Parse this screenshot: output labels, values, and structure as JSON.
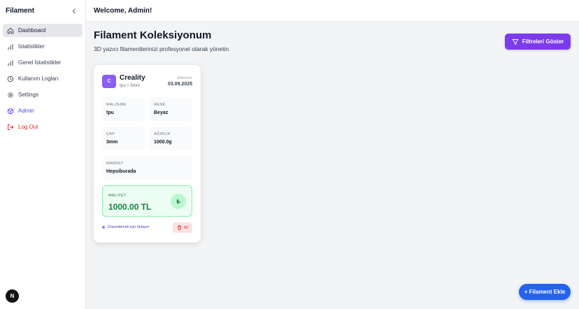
{
  "sidebar": {
    "brand": "Filament",
    "items": [
      {
        "label": "Dashboard",
        "icon": "home-icon"
      },
      {
        "label": "İstatistikler",
        "icon": "bar-chart-icon"
      },
      {
        "label": "Genel İstatistikler",
        "icon": "bar-chart-icon"
      },
      {
        "label": "Kullanım Logları",
        "icon": "clock-icon"
      },
      {
        "label": "Settings",
        "icon": "gear-icon"
      },
      {
        "label": "Admin",
        "icon": "cube-icon"
      },
      {
        "label": "Log Out",
        "icon": "logout-icon"
      }
    ],
    "badge": "N"
  },
  "topbar": {
    "title": "Welcome, Admin!"
  },
  "page": {
    "title": "Filament Koleksiyonum",
    "subtitle": "3D yazıcı filamentlerinizi profesyonel olarak yönetin",
    "filter_button": "Filtreleri Göster",
    "add_button": "+ Filament Ekle"
  },
  "card": {
    "avatar": "C",
    "name": "Creality",
    "meta": "tpu • 3mm",
    "added_label": "Eklenme",
    "added_date": "03.09.2025",
    "fields": {
      "material": {
        "label": "MALZEME",
        "value": "tpu"
      },
      "color": {
        "label": "RENK",
        "value": "Beyaz"
      },
      "diameter": {
        "label": "ÇAP",
        "value": "3mm"
      },
      "weight": {
        "label": "AĞIRLIK",
        "value": "1000.0g"
      },
      "market": {
        "label": "MARKET",
        "value": "Hepsiburada"
      }
    },
    "cost": {
      "label": "MALIYET",
      "value": "1000.00 TL",
      "symbol": "₺"
    },
    "hint": "Düzenlemek için tıklayın",
    "delete": "Sil"
  },
  "colors": {
    "primary": "#7c3aed",
    "accent_blue": "#2563eb",
    "success": "#15803d",
    "danger": "#dc2626"
  }
}
